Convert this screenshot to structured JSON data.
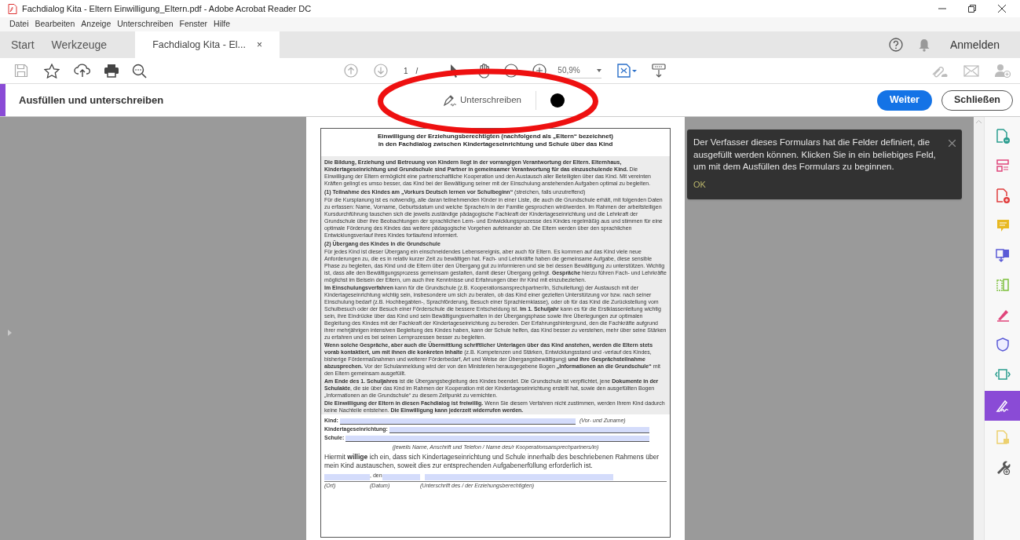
{
  "window": {
    "title": "Fachdialog Kita - Eltern Einwilligung_Eltern.pdf - Adobe Acrobat Reader DC"
  },
  "menu": [
    "Datei",
    "Bearbeiten",
    "Anzeige",
    "Unterschreiben",
    "Fenster",
    "Hilfe"
  ],
  "tabs": [
    {
      "label": "Start",
      "selected": false
    },
    {
      "label": "Werkzeuge",
      "selected": false
    },
    {
      "label": "Fachdialog Kita - El...",
      "selected": true,
      "close": "×"
    }
  ],
  "account": {
    "sign_in": "Anmelden"
  },
  "toolbar": {
    "page": "1",
    "page_separator": "/",
    "zoom": "50,9%"
  },
  "fill_sign_bar": {
    "title": "Ausfüllen und unterschreiben",
    "sign": "Unterschreiben",
    "buttons": [
      {
        "label": "Weiter",
        "primary": true
      },
      {
        "label": "Schließen",
        "primary": false
      }
    ]
  },
  "document": {
    "title_lines": [
      "Einwilligung der Erziehungsberechtigten (nachfolgend als „Eltern“ bezeichnet)",
      "in den Fachdialog zwischen Kindertageseinrichtung und Schule über das Kind"
    ],
    "blocks": [
      {
        "kind": "paragraph",
        "text": "**Die Bildung, Erziehung und Betreuung von Kindern liegt in der vorrangigen Verantwortung der Eltern. Elternhaus, Kindertageseinrichtung und Grundschule sind Partner in gemeinsamer Verantwortung für das einzuschulende Kind.** Die Einwilligung der Eltern ermöglicht eine partnerschaftliche Kooperation und den Austausch aller Beteiligten über das Kind. Mit vereinten Kräften gelingt es umso besser, das Kind bei der Bewältigung seiner mit der Einschulung anstehenden Aufgaben optimal zu begleiten."
      },
      {
        "kind": "heading",
        "text": "**(1) Teilnahme des Kindes am „Vorkurs Deutsch lernen vor Schulbeginn“** (streichen, falls unzutreffend)"
      },
      {
        "kind": "paragraph",
        "text": "Für die Kursplanung ist es notwendig, alle daran teilnehmenden Kinder in einer Liste, die auch die Grundschule erhält, mit folgenden Daten zu erfassen: Name, Vorname, Geburtsdatum und welche Sprache/n in der Familie gesprochen wird/werden. Im Rahmen der arbeitsteiligen Kursdurchführung tauschen sich die jeweils zuständige pädagogische Fachkraft der Kindertageseinrichtung und die Lehrkraft der Grundschule über ihre Beobachtungen der sprachlichen Lern- und Entwicklungsprozesse des Kindes regelmäßig aus und stimmen für eine optimale Förderung des Kindes das weitere pädagogische Vorgehen aufeinander ab. Die Eltern werden über den sprachlichen Entwicklungsverlauf ihres Kindes fortlaufend informiert."
      },
      {
        "kind": "heading",
        "text": "**(2) Übergang des Kindes in die Grundschule**"
      },
      {
        "kind": "paragraph",
        "text": "Für jedes Kind ist dieser Übergang ein einschneidendes Lebensereignis, aber auch für Eltern. Es kommen auf das Kind viele neue Anforderungen zu, die es in relativ kurzer Zeit zu bewältigen hat. Fach- und Lehrkräfte haben die gemeinsame Aufgabe, diese sensible Phase zu begleiten, das Kind und die Eltern über den Übergang gut zu informieren und sie bei dessen Bewältigung zu unterstützen. Wichtig ist, dass alle den Bewältigungsprozess gemeinsam gestalten, damit dieser Übergang gelingt. **Gespräche** hierzu führen Fach- und Lehrkräfte möglichst im Beisein der Eltern, um auch ihre Kenntnisse und Erfahrungen über ihr Kind mit einzubeziehen."
      },
      {
        "kind": "paragraph",
        "text": "**Im Einschulungsverfahren** kann für die Grundschule (z.B. Kooperationsansprechpartner/in, Schulleitung) der Austausch mit der Kindertageseinrichtung wichtig sein, insbesondere um sich zu beraten, ob das Kind einer gezielten Unterstützung vor bzw. nach seiner Einschulung bedarf (z.B. Hochbegabten-, Sprachförderung, Besuch einer Sprachlernklasse), oder ob für das Kind die Zurückstellung vom Schulbesuch oder der Besuch einer Förderschule die bessere Entscheidung ist. **Im 1. Schuljahr** kann es für die Erstklassenleitung wichtig sein, ihre Eindrücke über das Kind und sein Bewältigungsverhalten in der Übergangsphase sowie ihre Überlegungen zur optimalen Begleitung des Kindes mit der Fachkraft der Kindertageseinrichtung zu bereden. Der Erfahrungshintergrund, den die Fachkräfte aufgrund ihrer mehrjährigen intensiven Begleitung des Kindes haben, kann der Schule helfen, das Kind besser zu verstehen, mehr über seine Stärken zu erfahren und es bei seinen Lernprozessen besser zu begleiten."
      },
      {
        "kind": "paragraph",
        "text": "**Wenn solche Gespräche, aber auch die Übermittlung schriftlicher Unterlagen über das Kind anstehen, werden die Eltern stets vorab kontaktiert, um mit ihnen die konkreten Inhalte** (z.B. Kompetenzen und Stärken, Entwicklungsstand und -verlauf des Kindes, bisherige Fördermaßnahmen und weiterer Förderbedarf, Art und Weise der Übergangsbewältigung) **und ihre Gesprächsteilnahme abzusprechen.** Vor der Schulanmeldung wird der von den Ministerien herausgegebene Bogen **„Informationen an die Grundschule“** mit den Eltern gemeinsam ausgefüllt."
      },
      {
        "kind": "paragraph",
        "text": "**Am Ende des 1. Schuljahres** ist die Übergangsbegleitung des Kindes beendet. Die Grundschule ist verpflichtet, jene **Dokumente in der Schulakte**, die sie über das Kind im Rahmen der Kooperation mit der Kindertageseinrichtung erstellt hat, sowie den ausgefüllten Bogen „Informationen an die Grundschule“ zu diesem Zeitpunkt zu vernichten."
      },
      {
        "kind": "paragraph",
        "text": "**Die Einwilligung der Eltern in diesen Fachdialog ist freiwillig.** Wenn Sie diesem Verfahren nicht zustimmen, werden Ihrem Kind dadurch keine Nachteile entstehen. **Die Einwilligung kann jederzeit widerrufen werden.**"
      }
    ],
    "form_fields": [
      {
        "label": "Kind:",
        "hint": "(Vor- und Zuname)"
      },
      {
        "label": "Kindertageseinrichtung:"
      },
      {
        "label": "Schule:"
      }
    ],
    "fields_note": "(jeweils Name, Anschrift und Telefon / Name des/r Kooperationsansprechpartners/in)",
    "consent": "Hiermit **willige** ich ein, dass sich Kindertageseinrichtung und Schule innerhalb des beschriebenen Rahmens über mein Kind austauschen, soweit dies zur entsprechenden Aufgabenerfüllung erforderlich ist.",
    "date_separator": ", den",
    "signature_labels": [
      "(Ort)",
      "(Datum)",
      "(Unterschrift des / der Erziehungsberechtigten)"
    ]
  },
  "notice": {
    "text": "Der Verfasser dieses Formulars hat die Felder definiert, die ausgefüllt werden können. Klicken Sie in ein beliebiges Feld, um mit dem Ausfüllen des Formulars zu beginnen.",
    "ok": "OK"
  },
  "tool_panel": [
    {
      "kind": "export",
      "selected": false
    },
    {
      "kind": "form",
      "selected": false
    },
    {
      "kind": "create",
      "selected": false
    },
    {
      "kind": "comment",
      "selected": false
    },
    {
      "kind": "combine",
      "selected": false
    },
    {
      "kind": "organize",
      "selected": false
    },
    {
      "kind": "edit",
      "selected": false
    },
    {
      "kind": "protect",
      "selected": false
    },
    {
      "kind": "optimize",
      "selected": false
    },
    {
      "kind": "sign",
      "selected": true
    },
    {
      "kind": "file",
      "selected": false
    },
    {
      "kind": "more",
      "selected": false
    }
  ]
}
